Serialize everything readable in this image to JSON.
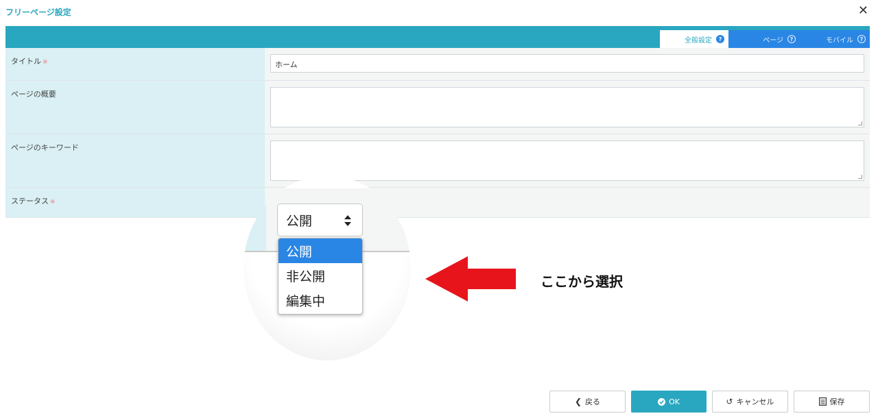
{
  "dialog": {
    "title": "フリーページ設定"
  },
  "tabs": [
    {
      "label": "全般設定"
    },
    {
      "label": "ページ"
    },
    {
      "label": "モバイル"
    }
  ],
  "form": {
    "title": {
      "label": "タイトル",
      "required_mark": "※",
      "value": "ホーム"
    },
    "summary": {
      "label": "ページの概要",
      "value": ""
    },
    "keywords": {
      "label": "ページのキーワード",
      "value": ""
    },
    "status": {
      "label": "ステータス",
      "required_mark": "※",
      "value": "公開",
      "options": [
        "公開",
        "非公開",
        "編集中"
      ]
    }
  },
  "annotation": {
    "text": "ここから選択",
    "arrow_color": "#e8141c"
  },
  "buttons": {
    "back": "戻る",
    "ok": "OK",
    "cancel": "キャンセル",
    "save": "保存"
  },
  "colors": {
    "accent": "#2aa7c0",
    "tab_blue": "#2a86e4",
    "label_bg": "#daf0f4",
    "required": "#f08080"
  }
}
